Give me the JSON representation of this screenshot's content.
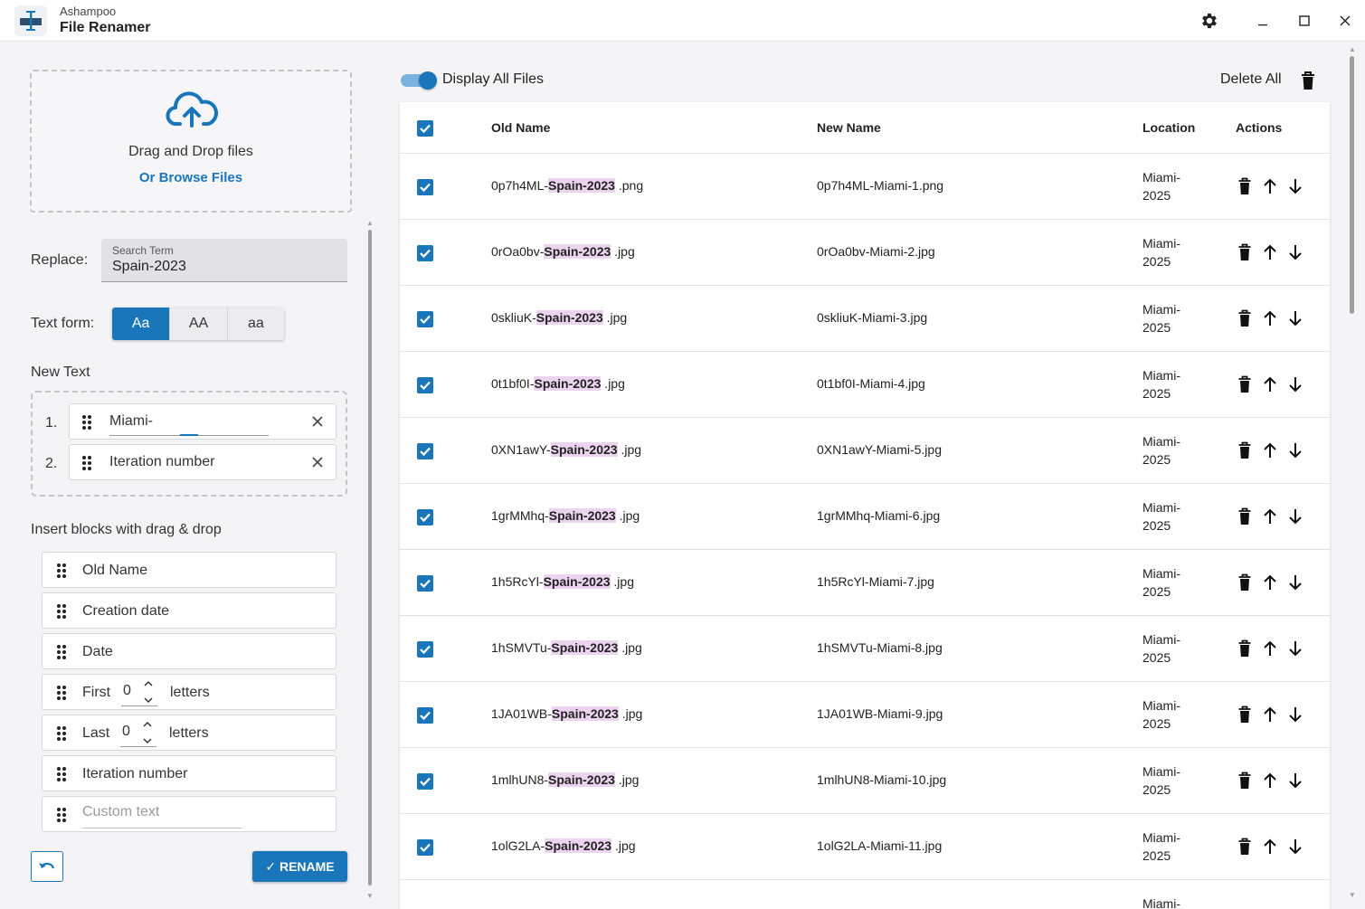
{
  "window": {
    "brand": "Ashampoo",
    "title": "File Renamer",
    "settings_icon": "gear-icon",
    "minimize_icon": "minimize-icon",
    "maximize_icon": "maximize-icon",
    "close_icon": "close-icon"
  },
  "colors": {
    "accent": "#1a76bb",
    "highlight": "#ecd3ef"
  },
  "dropzone": {
    "text": "Drag and Drop files",
    "browse": "Or Browse Files"
  },
  "replace": {
    "label": "Replace:",
    "field_label": "Search Term",
    "value": "Spain-2023"
  },
  "text_form": {
    "label": "Text form:",
    "options": [
      "Aa",
      "AA",
      "aa"
    ],
    "selected": "Aa"
  },
  "new_text": {
    "label": "New Text",
    "items": [
      {
        "num": "1.",
        "value": "Miami-"
      },
      {
        "num": "2.",
        "value": "Iteration number"
      }
    ]
  },
  "blocks": {
    "label": "Insert blocks with drag & drop",
    "old_name": "Old Name",
    "creation_date": "Creation date",
    "date": "Date",
    "first_label": "First",
    "first_value": "0",
    "last_label": "Last",
    "last_value": "0",
    "letters": "letters",
    "iteration": "Iteration number",
    "custom_placeholder": "Custom text"
  },
  "actions": {
    "rename": "✓ RENAME"
  },
  "files": {
    "toggle_label": "Display All Files",
    "toggle_on": true,
    "delete_all": "Delete All",
    "columns": {
      "old_name": "Old Name",
      "new_name": "New Name",
      "location": "Location",
      "actions": "Actions"
    },
    "rows": [
      {
        "prefix": "0p7h4ML-",
        "match": "Spain-2023",
        "ext": " .png",
        "new": "0p7h4ML-Miami-1.png",
        "loc1": "Miami-",
        "loc2": "2025"
      },
      {
        "prefix": "0rOa0bv-",
        "match": "Spain-2023",
        "ext": " .jpg",
        "new": "0rOa0bv-Miami-2.jpg",
        "loc1": "Miami-",
        "loc2": "2025"
      },
      {
        "prefix": "0skliuK-",
        "match": "Spain-2023",
        "ext": " .jpg",
        "new": "0skliuK-Miami-3.jpg",
        "loc1": "Miami-",
        "loc2": "2025"
      },
      {
        "prefix": "0t1bf0I-",
        "match": "Spain-2023",
        "ext": " .jpg",
        "new": "0t1bf0I-Miami-4.jpg",
        "loc1": "Miami-",
        "loc2": "2025"
      },
      {
        "prefix": "0XN1awY-",
        "match": "Spain-2023",
        "ext": " .jpg",
        "new": "0XN1awY-Miami-5.jpg",
        "loc1": "Miami-",
        "loc2": "2025"
      },
      {
        "prefix": "1grMMhq-",
        "match": "Spain-2023",
        "ext": " .jpg",
        "new": "1grMMhq-Miami-6.jpg",
        "loc1": "Miami-",
        "loc2": "2025"
      },
      {
        "prefix": "1h5RcYl-",
        "match": "Spain-2023",
        "ext": " .jpg",
        "new": "1h5RcYl-Miami-7.jpg",
        "loc1": "Miami-",
        "loc2": "2025"
      },
      {
        "prefix": "1hSMVTu-",
        "match": "Spain-2023",
        "ext": " .jpg",
        "new": "1hSMVTu-Miami-8.jpg",
        "loc1": "Miami-",
        "loc2": "2025"
      },
      {
        "prefix": "1JA01WB-",
        "match": "Spain-2023",
        "ext": " .jpg",
        "new": "1JA01WB-Miami-9.jpg",
        "loc1": "Miami-",
        "loc2": "2025"
      },
      {
        "prefix": "1mlhUN8-",
        "match": "Spain-2023",
        "ext": " .jpg",
        "new": "1mlhUN8-Miami-10.jpg",
        "loc1": "Miami-",
        "loc2": "2025"
      },
      {
        "prefix": "1olG2LA-",
        "match": "Spain-2023",
        "ext": " .jpg",
        "new": "1olG2LA-Miami-11.jpg",
        "loc1": "Miami-",
        "loc2": "2025"
      },
      {
        "prefix": "",
        "match": "",
        "ext": "",
        "new": "",
        "loc1": "Miami-",
        "loc2": ""
      }
    ]
  }
}
